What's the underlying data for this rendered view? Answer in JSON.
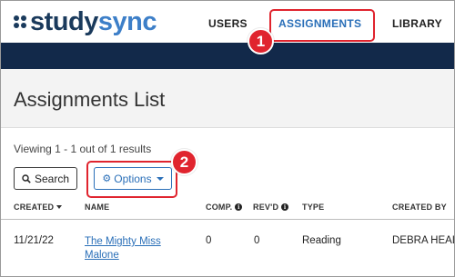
{
  "header": {
    "logo": {
      "part1": "study",
      "part2": "sync"
    },
    "nav": [
      {
        "label": "USERS"
      },
      {
        "label": "ASSIGNMENTS"
      },
      {
        "label": "LIBRARY"
      }
    ],
    "callouts": [
      "1",
      "2"
    ]
  },
  "page": {
    "title": "Assignments List",
    "viewing_text": "Viewing 1 - 1 out of 1 results"
  },
  "toolbar": {
    "search_label": "Search",
    "options_label": "Options"
  },
  "table": {
    "columns": [
      "CREATED",
      "NAME",
      "COMP.",
      "REV'D",
      "TYPE",
      "CREATED BY"
    ],
    "rows": [
      {
        "created": "11/21/22",
        "name": "The Mighty Miss Malone",
        "comp": "0",
        "revd": "0",
        "type": "Reading",
        "created_by": "DEBRA HEAL"
      }
    ]
  },
  "colors": {
    "brand_dark": "#1a3a5c",
    "brand_light": "#3d7fc8",
    "nav_bar": "#12294a",
    "link": "#2a6fb8",
    "callout": "#e0242e"
  },
  "icons": [
    "search-icon",
    "gear-icon",
    "caret-down-icon",
    "sort-caret-icon",
    "info-icon"
  ]
}
